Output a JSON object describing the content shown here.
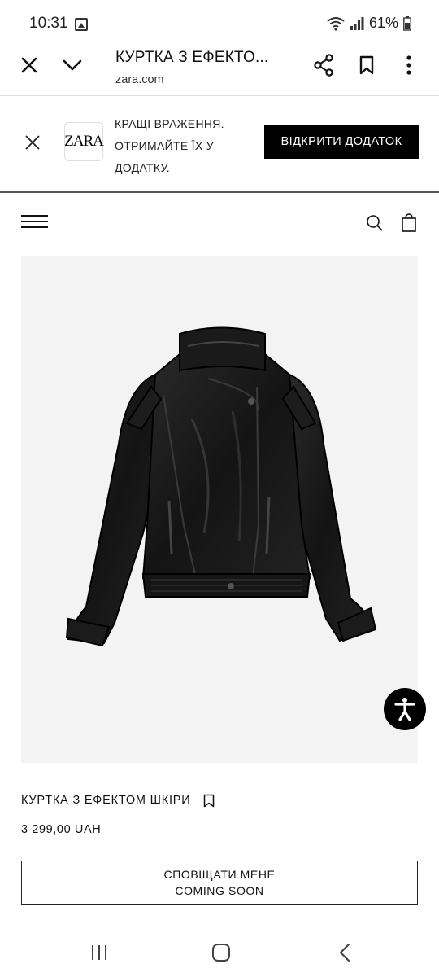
{
  "status_bar": {
    "time": "10:31",
    "battery": "61%"
  },
  "browser": {
    "title": "КУРТКА З ЕФЕКТО...",
    "url": "zara.com"
  },
  "app_banner": {
    "logo_text": "ZARA",
    "message_line1": "КРАЩІ ВРАЖЕННЯ.",
    "message_line2": "ОТРИМАЙТЕ ЇХ У",
    "message_line3": "ДОДАТКУ.",
    "open_button": "ВІДКРИТИ ДОДАТОК"
  },
  "product": {
    "name": "КУРТКА З ЕФЕКТОМ ШКІРИ",
    "price": "3 299,00 UAH",
    "notify_line1": "СПОВІЩАТИ МЕНЕ",
    "notify_line2": "COMING SOON"
  },
  "colors": {
    "primary": "#000000",
    "background": "#ffffff",
    "image_bg": "#f3f3f3"
  }
}
